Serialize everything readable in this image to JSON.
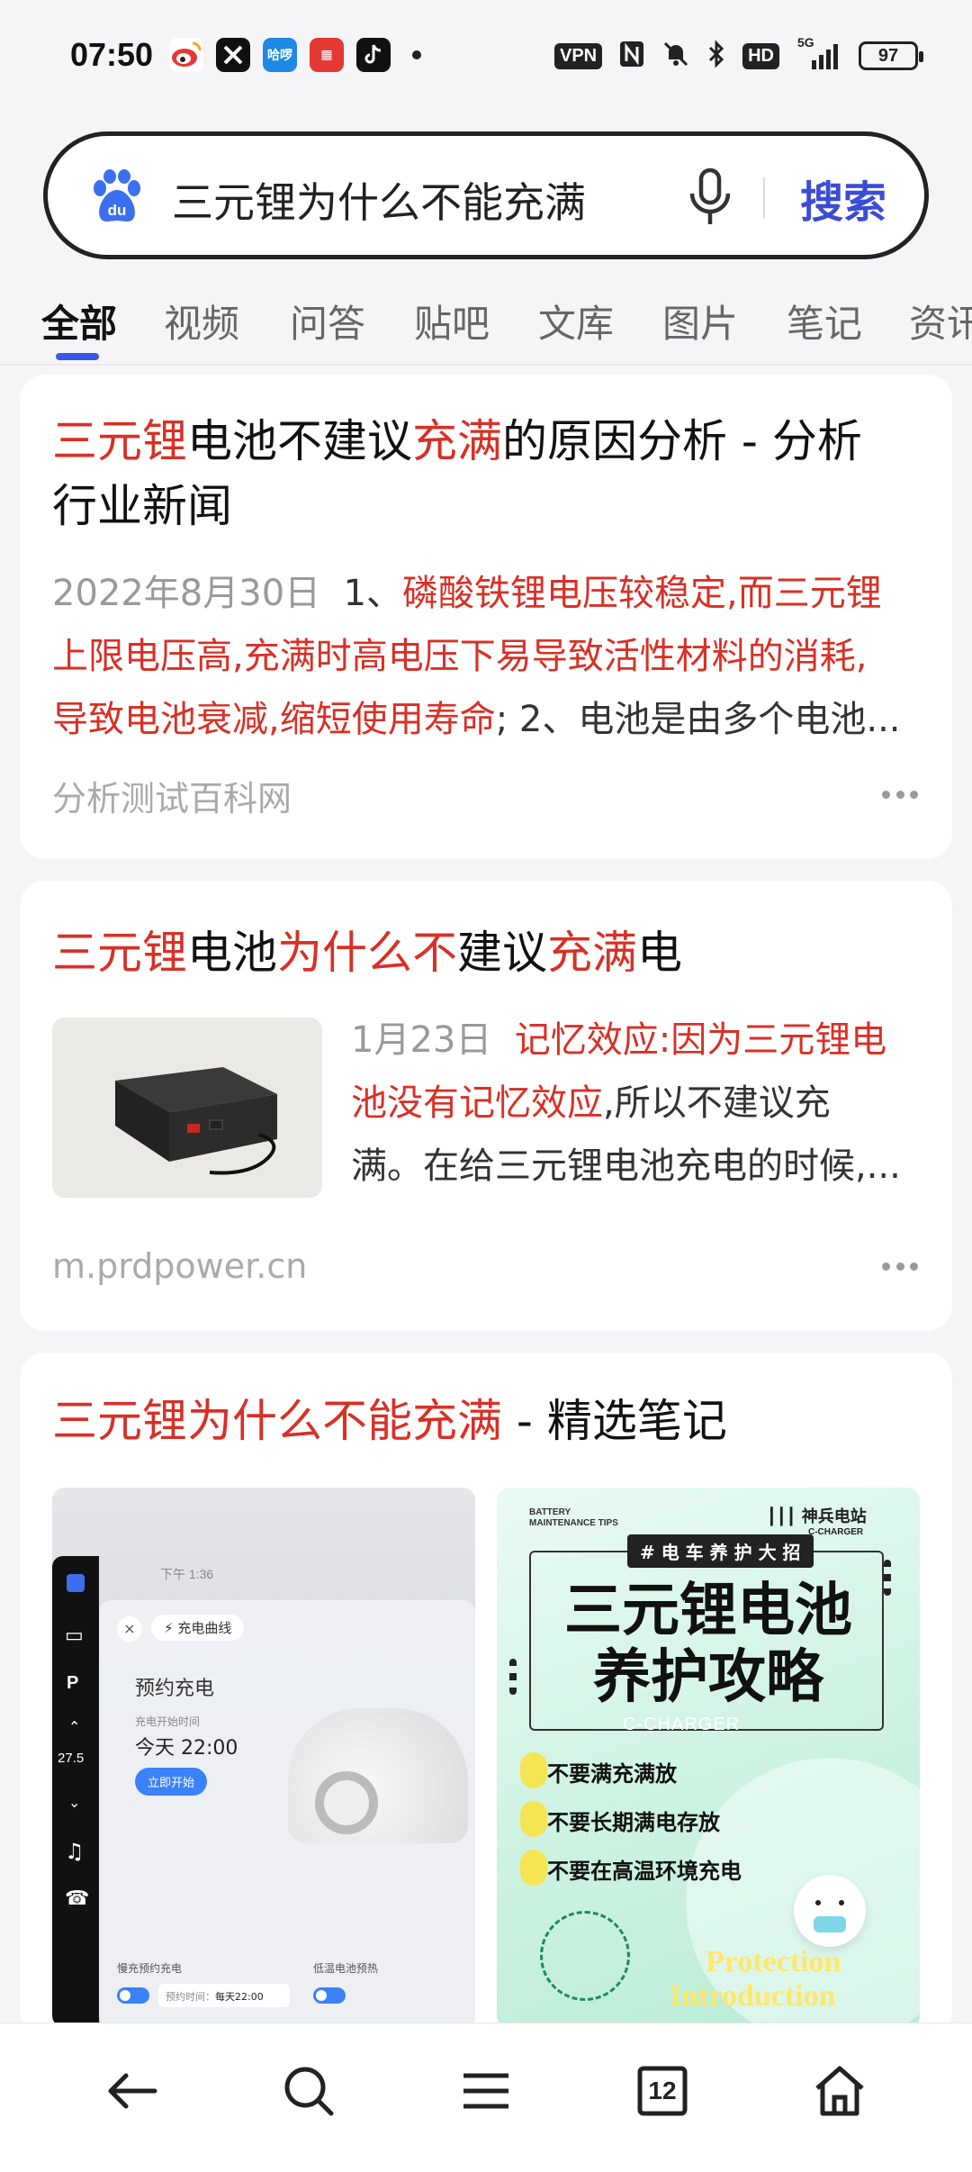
{
  "status_bar": {
    "time": "07:50",
    "apps": [
      {
        "icon": "weibo-icon",
        "color": "#f9a825"
      },
      {
        "icon": "x-app-icon",
        "color": "#111111"
      },
      {
        "icon": "hahaha-app-icon",
        "color": "#1e88e5",
        "label": "哈啰"
      },
      {
        "icon": "red-app-icon",
        "color": "#e53935"
      },
      {
        "icon": "tiktok-icon",
        "color": "#111111"
      }
    ],
    "vpn": "VPN",
    "hd": "HD",
    "network": "5G",
    "battery": "97"
  },
  "search": {
    "query": "三元锂为什么不能充满",
    "button": "搜索"
  },
  "tabs": [
    {
      "label": "全部",
      "active": true
    },
    {
      "label": "视频"
    },
    {
      "label": "问答"
    },
    {
      "label": "贴吧"
    },
    {
      "label": "文库"
    },
    {
      "label": "图片"
    },
    {
      "label": "笔记"
    },
    {
      "label": "资讯"
    }
  ],
  "results": [
    {
      "title_parts": [
        {
          "text": "三元锂",
          "hl": true
        },
        {
          "text": "电池不建议",
          "hl": false
        },
        {
          "text": "充满",
          "hl": true
        },
        {
          "text": "的原因分析 - 分析",
          "hl": false
        }
      ],
      "title_line2": "行业新闻",
      "date": "2022年8月30日",
      "snippet_l1_a": "1、",
      "snippet_l1_b": "磷酸铁锂电压较稳定,而三元锂",
      "snippet_l2": "上限电压高,充满时高电压下易导致活性材料的消耗,",
      "snippet_l3_a": "导致电池衰减,缩短使用寿命",
      "snippet_l3_b": "; 2、电池是由多个电池...",
      "source": "分析测试百科网"
    },
    {
      "title_parts": [
        {
          "text": "三元锂",
          "hl": true
        },
        {
          "text": "电池",
          "hl": false
        },
        {
          "text": "为什么不",
          "hl": true
        },
        {
          "text": "建议",
          "hl": false
        },
        {
          "text": "充满",
          "hl": true
        },
        {
          "text": "电",
          "hl": false
        }
      ],
      "date": "1月23日",
      "snippet_l1": "记忆效应:因为三元锂电",
      "snippet_l2_a": "池没有记忆效应",
      "snippet_l2_b": ",所以不建议充",
      "snippet_l3": "满。在给三元锂电池充电的时候,...",
      "source": "m.prdpower.cn"
    },
    {
      "title_hl": "三元锂为什么不能充满",
      "title_rest": " - 精选笔记",
      "note1": {
        "status_time": "下午 1:36",
        "tab": "充电曲线",
        "heading": "预约充电",
        "sub": "充电开始时间",
        "time": "今天 22:00",
        "button": "立即开始",
        "left_label": "慢充预约充电",
        "left_value": "每天22:00",
        "left_value_prefix": "预约时间：",
        "right_label": "低温电池预热",
        "temp": "27.5"
      },
      "note2": {
        "brand_left_1": "BATTERY",
        "brand_left_2": "MAINTENANCE TIPS",
        "brand_right": "神兵电站",
        "brand_right_sub": "C-CHARGER",
        "tag": "# 电 车 养 护 大 招",
        "title_l1": "三元锂电池",
        "title_l2": "养护攻略",
        "watermark": "C-CHARGER",
        "items": [
          "不要满充满放",
          "不要长期满电存放",
          "不要在高温环境充电"
        ],
        "footer_1": "Protection",
        "footer_2": "Introduction"
      }
    }
  ],
  "bottom_nav": {
    "tab_count": "12"
  }
}
